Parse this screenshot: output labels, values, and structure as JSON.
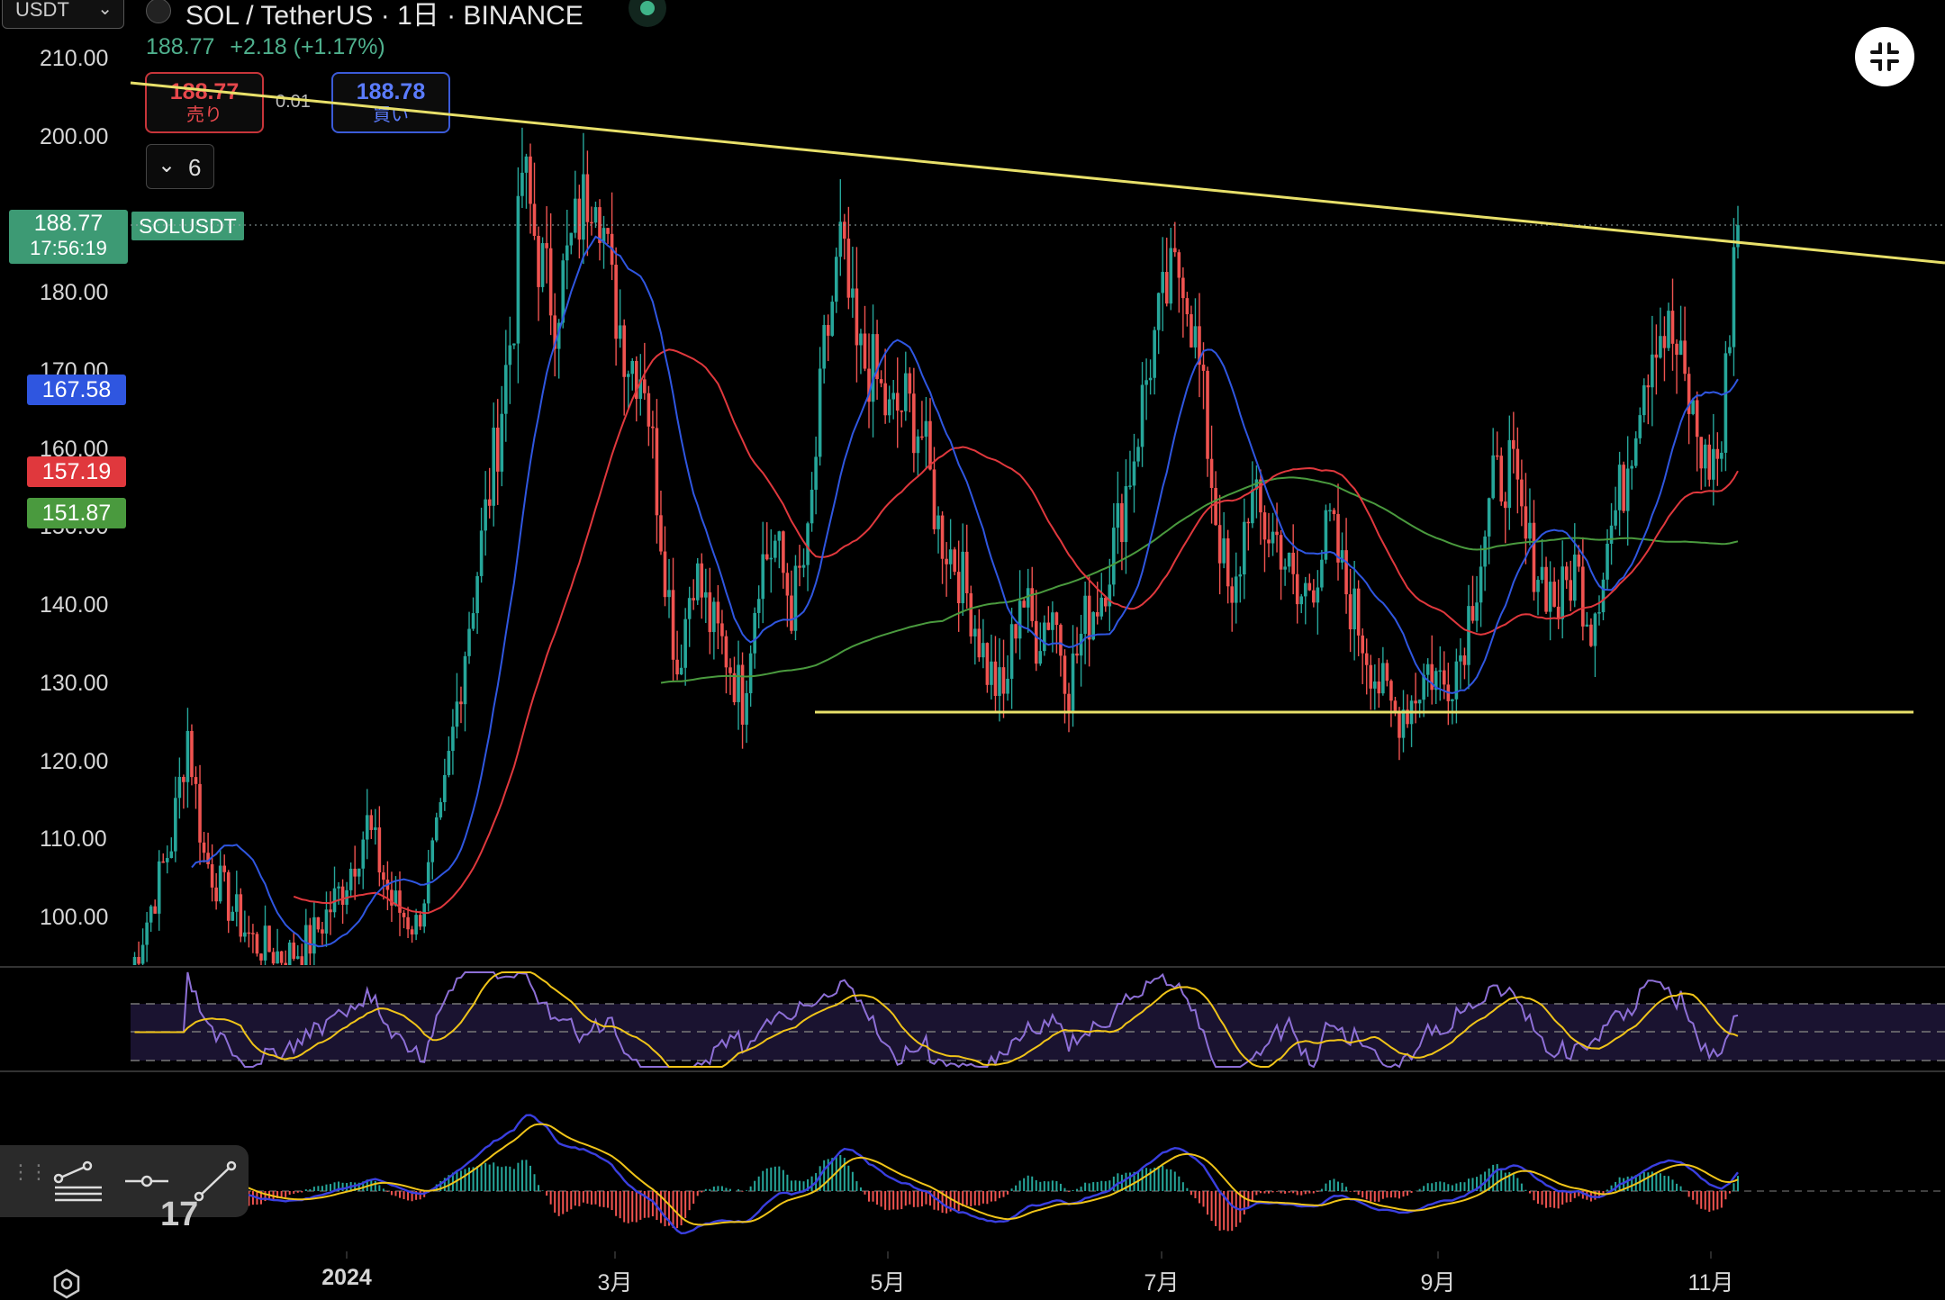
{
  "header": {
    "currency": "USDT",
    "symbol_line": "SOL / TetherUS · 1日 · BINANCE",
    "last_price": "188.77",
    "change": "+2.18 (+1.17%)"
  },
  "order": {
    "sell_price": "188.77",
    "sell_label": "売り",
    "spread": "0.01",
    "buy_price": "188.78",
    "buy_label": "買い"
  },
  "indicator_toggle": {
    "count": "6"
  },
  "price_axis": {
    "ticks": [
      "210.00",
      "200.00",
      "180.00",
      "170.00",
      "160.00",
      "150.00",
      "140.00",
      "130.00",
      "120.00",
      "110.00",
      "100.00"
    ]
  },
  "price_tags": {
    "last": {
      "price": "188.77",
      "countdown": "17:56:19",
      "symbol": "SOLUSDT",
      "color": "#3d9a74"
    },
    "ma_blue": {
      "value": "167.58",
      "color": "#2f56e0"
    },
    "ma_red": {
      "value": "157.19",
      "color": "#e0383d"
    },
    "ma_green": {
      "value": "151.87",
      "color": "#4a9a3e"
    }
  },
  "time_axis": {
    "labels": [
      "2024",
      "3月",
      "5月",
      "7月",
      "9月",
      "11月"
    ]
  },
  "colors": {
    "up": "#26a69a",
    "down": "#ef5350",
    "trendline": "#e8e06a",
    "rsi": "#8d6fd6",
    "macd": "#3a3fe0",
    "signal": "#f0c419"
  },
  "icons": {
    "collapse": "collapse-arrows-icon",
    "settings": "hexagon-gear-icon",
    "multi_line_tool": "multi-line-tool-icon",
    "horizontal_ray_tool": "horizontal-ray-tool-icon",
    "trend_line_tool": "trend-line-tool-icon"
  },
  "chart_data": {
    "type": "candlestick",
    "title": "SOL / TetherUS · 1日 · BINANCE",
    "ylim": [
      94,
      212
    ],
    "y_ticks": [
      210,
      200,
      180,
      170,
      160,
      150,
      140,
      130,
      120,
      110,
      100
    ],
    "x_labels": [
      "2024",
      "3月",
      "5月",
      "7月",
      "9月",
      "11月"
    ],
    "last_price": 188.77,
    "moving_averages": [
      {
        "value": 167.58,
        "color": "#2f56e0"
      },
      {
        "value": 157.19,
        "color": "#e0383d"
      },
      {
        "value": 151.87,
        "color": "#4a9a3e"
      }
    ],
    "support_level": 126.4,
    "price_path": [
      [
        0,
        93
      ],
      [
        10,
        110
      ],
      [
        14,
        124
      ],
      [
        18,
        108
      ],
      [
        24,
        102
      ],
      [
        30,
        97
      ],
      [
        38,
        95
      ],
      [
        44,
        97
      ],
      [
        52,
        104
      ],
      [
        58,
        112
      ],
      [
        64,
        102
      ],
      [
        70,
        99
      ],
      [
        76,
        112
      ],
      [
        82,
        135
      ],
      [
        86,
        148
      ],
      [
        90,
        162
      ],
      [
        94,
        178
      ],
      [
        96,
        196
      ],
      [
        100,
        185
      ],
      [
        104,
        178
      ],
      [
        110,
        190
      ],
      [
        114,
        196
      ],
      [
        118,
        180
      ],
      [
        122,
        172
      ],
      [
        126,
        170
      ],
      [
        130,
        150
      ],
      [
        134,
        132
      ],
      [
        138,
        145
      ],
      [
        142,
        138
      ],
      [
        146,
        134
      ],
      [
        150,
        128
      ],
      [
        154,
        145
      ],
      [
        158,
        148
      ],
      [
        162,
        140
      ],
      [
        166,
        147
      ],
      [
        170,
        172
      ],
      [
        174,
        186
      ],
      [
        178,
        172
      ],
      [
        182,
        170
      ],
      [
        186,
        164
      ],
      [
        190,
        166
      ],
      [
        194,
        162
      ],
      [
        198,
        150
      ],
      [
        202,
        146
      ],
      [
        206,
        140
      ],
      [
        210,
        132
      ],
      [
        214,
        128
      ],
      [
        218,
        142
      ],
      [
        222,
        136
      ],
      [
        226,
        140
      ],
      [
        230,
        130
      ],
      [
        234,
        138
      ],
      [
        238,
        142
      ],
      [
        242,
        150
      ],
      [
        246,
        160
      ],
      [
        250,
        172
      ],
      [
        254,
        180
      ],
      [
        258,
        184
      ],
      [
        262,
        170
      ],
      [
        266,
        152
      ],
      [
        270,
        138
      ],
      [
        274,
        154
      ],
      [
        278,
        150
      ],
      [
        282,
        148
      ],
      [
        286,
        140
      ],
      [
        290,
        144
      ],
      [
        294,
        150
      ],
      [
        298,
        142
      ],
      [
        302,
        136
      ],
      [
        306,
        130
      ],
      [
        310,
        126
      ],
      [
        314,
        128
      ],
      [
        318,
        132
      ],
      [
        322,
        130
      ],
      [
        326,
        134
      ],
      [
        330,
        144
      ],
      [
        334,
        155
      ],
      [
        338,
        158
      ],
      [
        342,
        148
      ],
      [
        346,
        144
      ],
      [
        350,
        140
      ],
      [
        354,
        145
      ],
      [
        358,
        138
      ],
      [
        362,
        148
      ],
      [
        366,
        156
      ],
      [
        370,
        168
      ],
      [
        374,
        176
      ],
      [
        378,
        174
      ],
      [
        382,
        166
      ],
      [
        386,
        158
      ],
      [
        390,
        160
      ],
      [
        393,
        186
      ],
      [
        394,
        188.77
      ]
    ]
  }
}
